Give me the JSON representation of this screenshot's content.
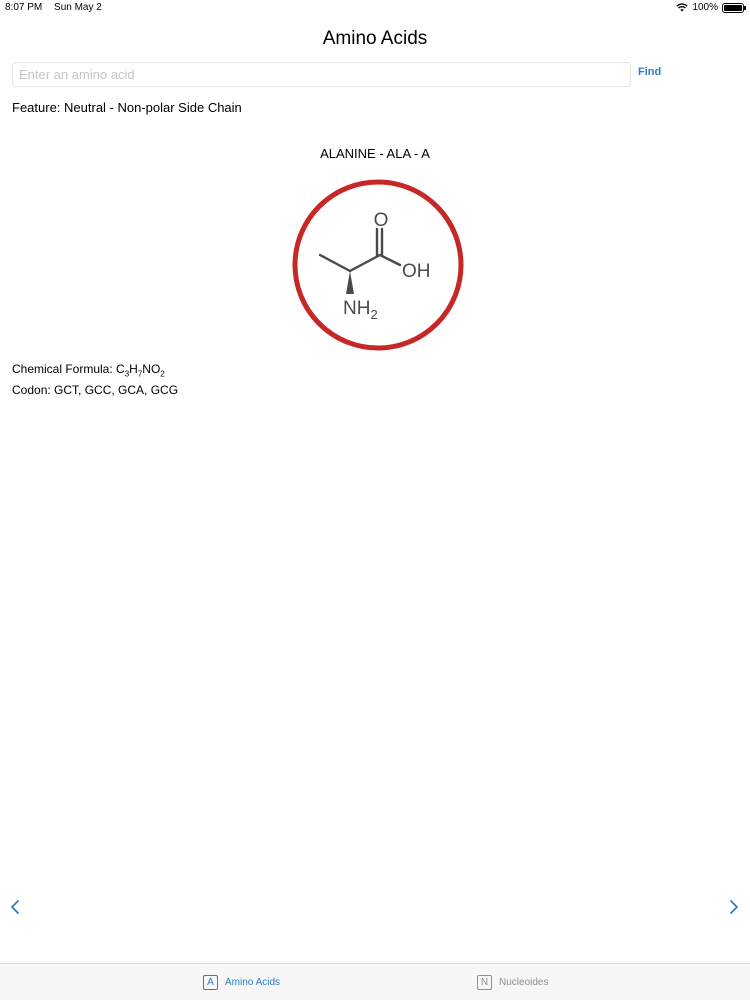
{
  "status_bar": {
    "time": "8:07 PM",
    "date": "Sun May 2",
    "battery": "100%",
    "battery_level": 1.0
  },
  "nav": {
    "title": "Amino Acids"
  },
  "search": {
    "placeholder": "Enter an amino acid",
    "value": "",
    "find_label": "Find"
  },
  "amino_acid": {
    "feature": "Feature: Neutral - Non-polar Side Chain",
    "name": "ALANINE - ALA - A",
    "structure_labels": {
      "carbonyl": "O",
      "hydroxyl": "OH",
      "amine": "NH",
      "amine_sub": "2"
    },
    "formula_label": "Chemical Formula: ",
    "formula_parts": [
      "C",
      "3",
      "H",
      "7",
      "NO",
      "2"
    ],
    "codon": "Codon: GCT, GCC, GCA, GCG"
  },
  "navigation": {
    "prev_icon": "chevron-left-icon",
    "next_icon": "chevron-right-icon"
  },
  "tabs": [
    {
      "label": "Amino Acids",
      "icon_letter": "A",
      "selected": true
    },
    {
      "label": "Nucleoides",
      "icon_letter": "N",
      "selected": false
    }
  ],
  "colors": {
    "accent": "#2f7bc6",
    "ring": "#c62828",
    "structure": "#4a4a4a",
    "tab_inactive": "#8e8e93"
  }
}
